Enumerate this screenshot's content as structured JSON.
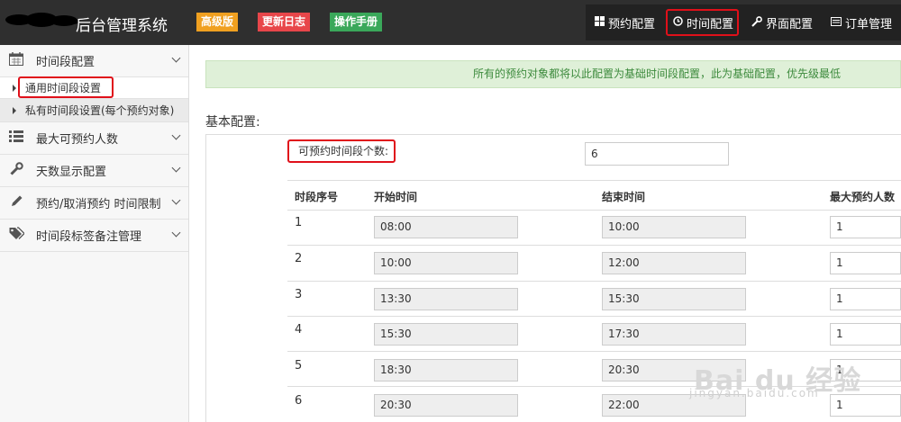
{
  "header": {
    "app_title": "后台管理系统",
    "badges": [
      {
        "label": "高级版",
        "color": "#f0a020"
      },
      {
        "label": "更新日志",
        "color": "#e8464a"
      },
      {
        "label": "操作手册",
        "color": "#3aa85a"
      }
    ],
    "nav": [
      {
        "label": "预约配置",
        "icon": "grid-icon"
      },
      {
        "label": "时间配置",
        "icon": "clock-icon",
        "active": true
      },
      {
        "label": "界面配置",
        "icon": "wrench-icon"
      },
      {
        "label": "订单管理",
        "icon": "card-icon"
      }
    ]
  },
  "sidebar": {
    "groups": [
      {
        "label": "时间段配置",
        "icon": "calendar-icon"
      },
      {
        "label": "最大可预约人数",
        "icon": "list-icon"
      },
      {
        "label": "天数显示配置",
        "icon": "wrench-icon"
      },
      {
        "label": "预约/取消预约 时间限制",
        "icon": "pencil-icon"
      },
      {
        "label": "时间段标签备注管理",
        "icon": "tags-icon"
      }
    ],
    "sub_items": [
      {
        "label": "通用时间段设置"
      },
      {
        "label": "私有时间段设置(每个预约对象)"
      }
    ]
  },
  "main": {
    "notice": "所有的预约对象都将以此配置为基础时间段配置，此为基础配置，优先级最低",
    "section_title": "基本配置:",
    "count_label": "可预约时间段个数:",
    "count_value": "6",
    "table": {
      "headers": [
        "时段序号",
        "开始时间",
        "结束时间",
        "最大预约人数"
      ],
      "rows": [
        {
          "num": "1",
          "start": "08:00",
          "end": "10:00",
          "max": "1"
        },
        {
          "num": "2",
          "start": "10:00",
          "end": "12:00",
          "max": "1"
        },
        {
          "num": "3",
          "start": "13:30",
          "end": "15:30",
          "max": "1"
        },
        {
          "num": "4",
          "start": "15:30",
          "end": "17:30",
          "max": "1"
        },
        {
          "num": "5",
          "start": "18:30",
          "end": "20:30",
          "max": "1"
        },
        {
          "num": "6",
          "start": "20:30",
          "end": "22:00",
          "max": "1"
        }
      ]
    }
  },
  "watermark": {
    "text": "Bai du 经验",
    "sub": "jingyan.baidu.com"
  }
}
